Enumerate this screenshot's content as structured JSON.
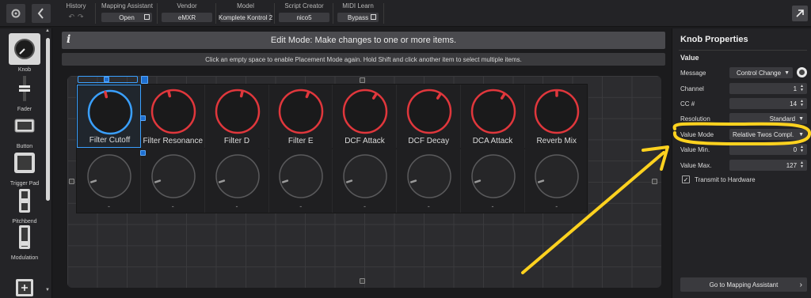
{
  "toolbar": {
    "back_icon": "chevron-left-icon",
    "history_label": "History",
    "undo_icon": "undo-icon",
    "redo_icon": "redo-icon",
    "mapping_assistant_label": "Mapping Assistant",
    "mapping_assistant_value": "Open",
    "vendor_label": "Vendor",
    "vendor_value": "eMXR",
    "model_label": "Model",
    "model_value": "Komplete Kontrol 2",
    "script_creator_label": "Script Creator",
    "script_creator_value": "nico5",
    "midi_learn_label": "MIDI Learn",
    "midi_learn_value": "Bypass",
    "expand_icon": "expand-arrow-icon"
  },
  "palette": {
    "items": [
      {
        "label": "Knob",
        "icon": "knob-icon",
        "selected": true
      },
      {
        "label": "Fader",
        "icon": "fader-icon",
        "selected": false
      },
      {
        "label": "Button",
        "icon": "button-icon",
        "selected": false
      },
      {
        "label": "Trigger Pad",
        "icon": "trigger-pad-icon",
        "selected": false
      },
      {
        "label": "Pitchbend",
        "icon": "pitchbend-icon",
        "selected": false
      },
      {
        "label": "Modulation",
        "icon": "modulation-icon",
        "selected": false
      }
    ],
    "add_icon": "plus-icon"
  },
  "main": {
    "info_glyph": "i",
    "edit_mode_text": "Edit Mode: Make changes to one or more items.",
    "hint_text": "Click an empty space to enable Placement Mode again. Hold Shift and click another item to select multiple items.",
    "knobs_row1": [
      {
        "name": "Filter Cutoff",
        "selected": true,
        "value": 0.45
      },
      {
        "name": "Filter Resonance",
        "selected": false,
        "value": 0.45
      },
      {
        "name": "Filter D",
        "selected": false,
        "value": 0.55
      },
      {
        "name": "Filter E",
        "selected": false,
        "value": 0.58
      },
      {
        "name": "DCF Attack",
        "selected": false,
        "value": 0.62
      },
      {
        "name": "DCF Decay",
        "selected": false,
        "value": 0.62
      },
      {
        "name": "DCA Attack",
        "selected": false,
        "value": 0.62
      },
      {
        "name": "Reverb Mix",
        "selected": false,
        "value": 0.5
      }
    ],
    "knobs_row2_label": "-",
    "knobs_row2_count": 8
  },
  "properties": {
    "title": "Knob Properties",
    "section": "Value",
    "rows": [
      {
        "label": "Message",
        "value": "Control Change",
        "kind": "select"
      },
      {
        "label": "Channel",
        "value": "1",
        "kind": "spin"
      },
      {
        "label": "CC #",
        "value": "14",
        "kind": "spin"
      },
      {
        "label": "Resolution",
        "value": "Standard",
        "kind": "select"
      },
      {
        "label": "Value Mode",
        "value": "Relative Twos Compl.",
        "kind": "select"
      },
      {
        "label": "Value Min.",
        "value": "0",
        "kind": "spin"
      },
      {
        "label": "Value Max.",
        "value": "127",
        "kind": "spin"
      }
    ],
    "transmit_label": "Transmit to Hardware",
    "transmit_checked": true,
    "goto_label": "Go to Mapping Assistant"
  },
  "colors": {
    "accent_blue": "#3aa0ff",
    "knob_red": "#e0373c",
    "annotation_yellow": "#ffd21f"
  }
}
